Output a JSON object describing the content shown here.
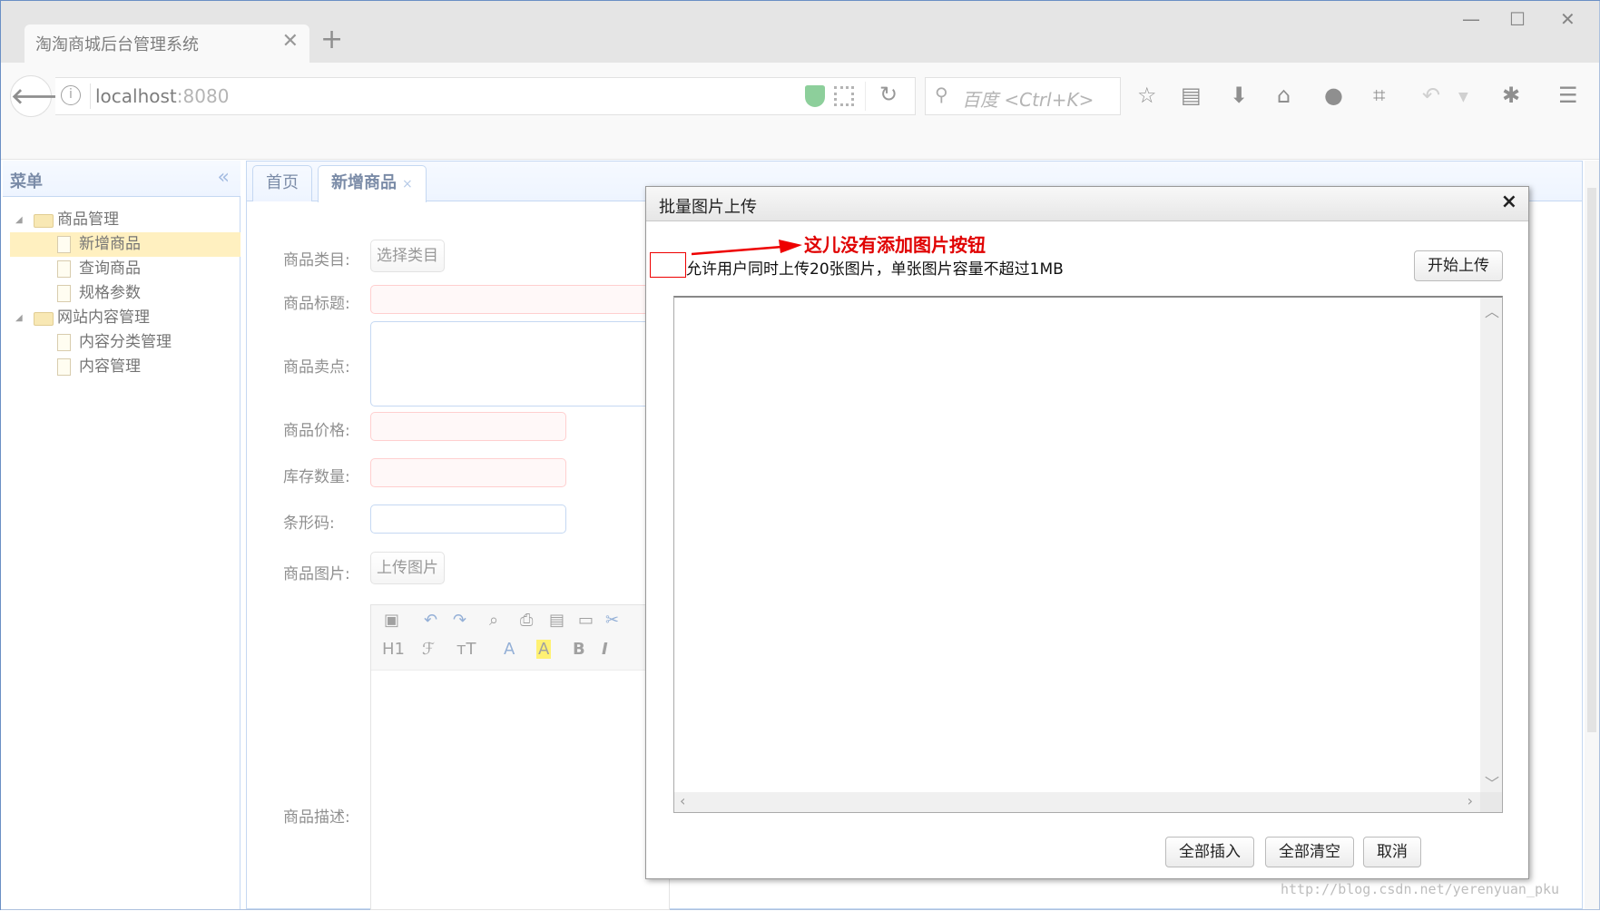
{
  "browser": {
    "tab_title": "淘淘商城后台管理系统",
    "tab_close": "✕",
    "new_tab": "+",
    "win_minimize": "—",
    "win_maximize": "☐",
    "win_close": "✕",
    "url_host": "localhost",
    "url_port": ":8080",
    "search_placeholder": "百度 <Ctrl+K>",
    "icons": [
      "back-arrow-icon",
      "info-icon",
      "shield-icon",
      "qr-code-icon",
      "reload-icon",
      "search-icon",
      "bookmark-star-icon",
      "reading-list-icon",
      "download-icon",
      "home-icon",
      "chat-icon",
      "crop-icon",
      "undo-icon",
      "dropdown-icon",
      "bug-icon",
      "menu-icon"
    ]
  },
  "sidebar": {
    "title": "菜单",
    "collapse": "«",
    "tree": [
      {
        "label": "商品管理",
        "type": "folder",
        "children": [
          {
            "label": "新增商品",
            "selected": true
          },
          {
            "label": "查询商品"
          },
          {
            "label": "规格参数"
          }
        ]
      },
      {
        "label": "网站内容管理",
        "type": "folder",
        "children": [
          {
            "label": "内容分类管理"
          },
          {
            "label": "内容管理"
          }
        ]
      }
    ]
  },
  "main": {
    "tabs": [
      {
        "label": "首页",
        "active": false
      },
      {
        "label": "新增商品",
        "active": true,
        "close": "×"
      }
    ],
    "form": {
      "category_label": "商品类目:",
      "category_button": "选择类目",
      "title_label": "商品标题:",
      "sell_point_label": "商品卖点:",
      "price_label": "商品价格:",
      "stock_label": "库存数量:",
      "barcode_label": "条形码:",
      "image_label": "商品图片:",
      "image_button": "上传图片",
      "desc_label": "商品描述:"
    },
    "editor_toolbar": {
      "heading": "H1",
      "font": "ℱ",
      "fontsize": "тT",
      "forecolor": "A",
      "hilite": "A",
      "bold": "B",
      "italic": "I"
    }
  },
  "dialog": {
    "title": "批量图片上传",
    "close": "×",
    "annotation": "这儿没有添加图片按钮",
    "note": "允许用户同时上传20张图片，单张图片容量不超过1MB",
    "start_upload": "开始上传",
    "insert_all": "全部插入",
    "clear_all": "全部清空",
    "cancel": "取消"
  },
  "watermark": "http://blog.csdn.net/yerenyuan_pku",
  "colors": {
    "accent_border": "#95b8e7",
    "selected_node": "#ffe48d",
    "annotation_red": "#e00000"
  }
}
